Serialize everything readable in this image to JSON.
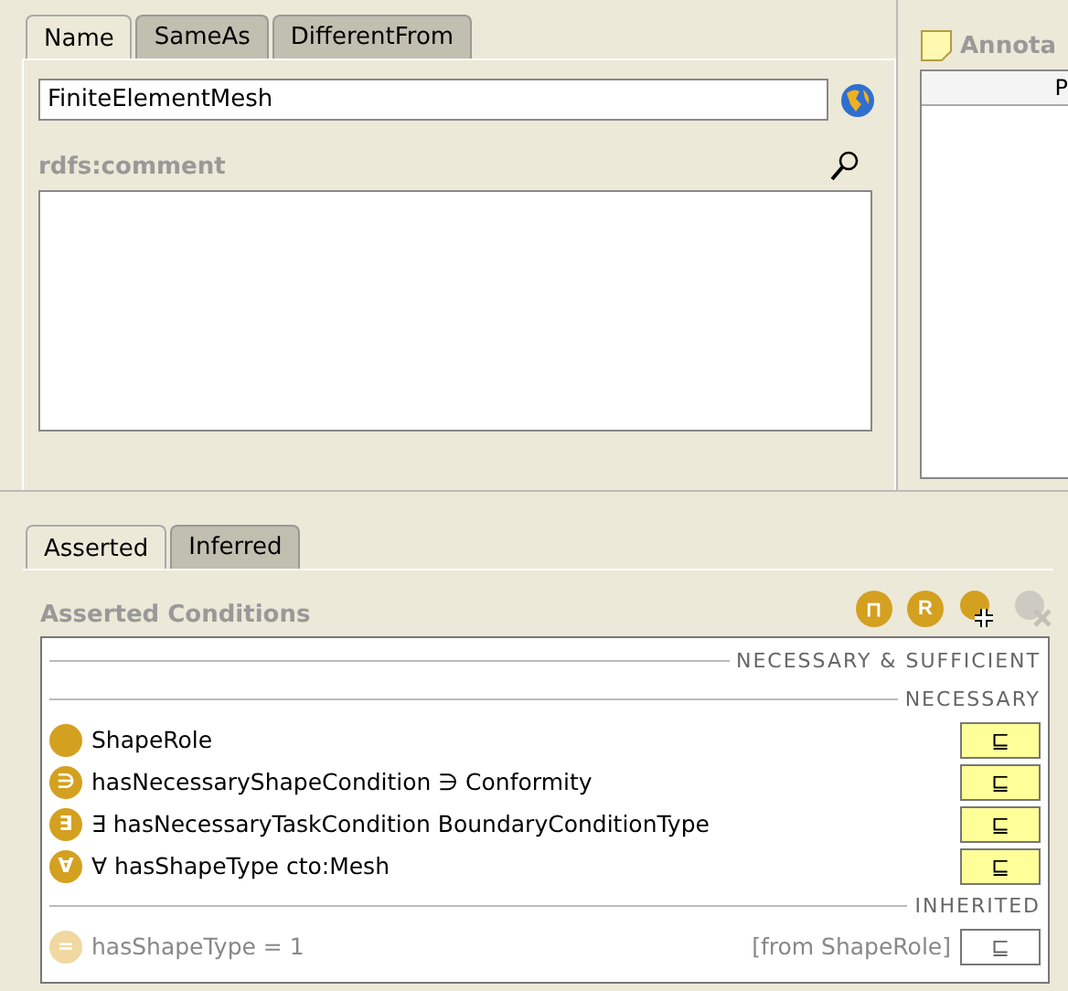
{
  "name_tabs": [
    {
      "label": "Name",
      "selected": true
    },
    {
      "label": "SameAs",
      "selected": false
    },
    {
      "label": "DifferentFrom",
      "selected": false
    }
  ],
  "name_field": {
    "value": "FiniteElementMesh"
  },
  "comment": {
    "label": "rdfs:comment"
  },
  "annotations": {
    "title": "Annota",
    "column_1": "P"
  },
  "condition_tabs": [
    {
      "label": "Asserted",
      "selected": true
    },
    {
      "label": "Inferred",
      "selected": false
    }
  ],
  "conditions": {
    "title": "Asserted Conditions",
    "toolbar": [
      {
        "kind": "intersection",
        "glyph": "⊓",
        "disabled": false
      },
      {
        "kind": "restriction",
        "glyph": "R",
        "disabled": false
      },
      {
        "kind": "add",
        "disabled": false
      },
      {
        "kind": "delete",
        "disabled": true
      }
    ],
    "sections": [
      {
        "heading": "NECESSARY & SUFFICIENT"
      },
      {
        "heading": "NECESSARY",
        "rows": [
          {
            "kind": "class",
            "text": "ShapeRole",
            "relation": "⊑",
            "inherited": false
          },
          {
            "kind": "restriction",
            "glyph": "∋",
            "text": "hasNecessaryShapeCondition ∋ Conformity",
            "relation": "⊑",
            "inherited": false
          },
          {
            "kind": "restriction",
            "glyph": "∃",
            "text": "∃ hasNecessaryTaskCondition BoundaryConditionType",
            "relation": "⊑",
            "inherited": false
          },
          {
            "kind": "restriction",
            "glyph": "∀",
            "text": "∀ hasShapeType cto:Mesh",
            "relation": "⊑",
            "inherited": false
          }
        ]
      },
      {
        "heading": "INHERITED",
        "rows": [
          {
            "kind": "restriction",
            "glyph": "=",
            "text": "hasShapeType = 1",
            "origin": "[from ShapeRole]",
            "relation": "⊑",
            "inherited": true
          }
        ]
      }
    ]
  }
}
